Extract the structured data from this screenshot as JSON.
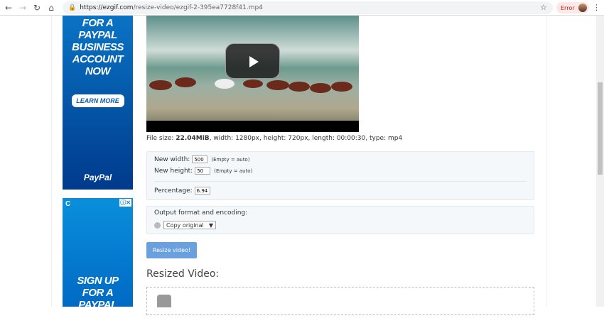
{
  "browser": {
    "url_host": "https://ezgif.com",
    "url_path": "/resize-video/ezgif-2-395ea7728f41.mp4",
    "error_label": "Error"
  },
  "ads": {
    "top": {
      "text": "FOR A PAYPAL BUSINESS ACCOUNT NOW",
      "button": "LEARN MORE",
      "brand": "PayPal"
    },
    "bottom": {
      "text": "SIGN UP FOR A PAYPAL BUSINESS"
    }
  },
  "video": {
    "info_prefix": "File size: ",
    "file_size": "22.04MiB",
    "info_rest": ", width: 1280px, height: 720px, length: 00:00:30, type: mp4"
  },
  "form": {
    "width_label": "New width:",
    "width_value": "500",
    "height_label": "New height:",
    "height_value": "50",
    "auto_hint": "(Empty = auto)",
    "percentage_label": "Percentage:",
    "percentage_value": "6.94",
    "output_label": "Output format and encoding:",
    "output_value": "Copy original",
    "submit": "Resize video!"
  },
  "result": {
    "title": "Resized Video:"
  },
  "colors": {
    "accent": "#6aa0de",
    "ad_blue": "#0a73c4"
  }
}
